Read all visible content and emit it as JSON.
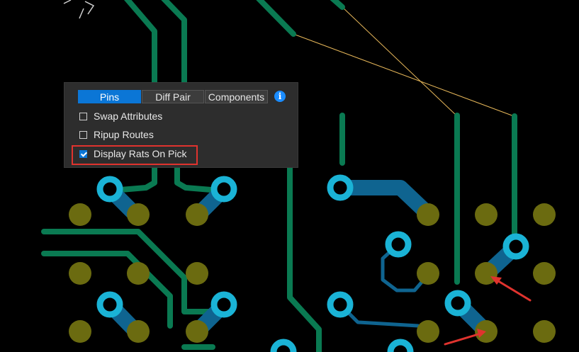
{
  "panel": {
    "tabs": [
      {
        "label": "Pins",
        "active": true
      },
      {
        "label": "Diff Pair",
        "active": false
      },
      {
        "label": "Components",
        "active": false
      }
    ],
    "info_icon": "i",
    "options": [
      {
        "label": "Swap Attributes",
        "checked": false
      },
      {
        "label": "Ripup Routes",
        "checked": false
      },
      {
        "label": "Display Rats On Pick",
        "checked": true,
        "highlighted": true
      }
    ]
  },
  "colors": {
    "background": "#000000",
    "trace": "#0a7a52",
    "via": "#1ab3d6",
    "pad": "#6b6b10",
    "copper_fill": "#0f6490",
    "ratsnest": "#e8b85a",
    "annotation": "#e0332e",
    "accent": "#0b76d6"
  }
}
